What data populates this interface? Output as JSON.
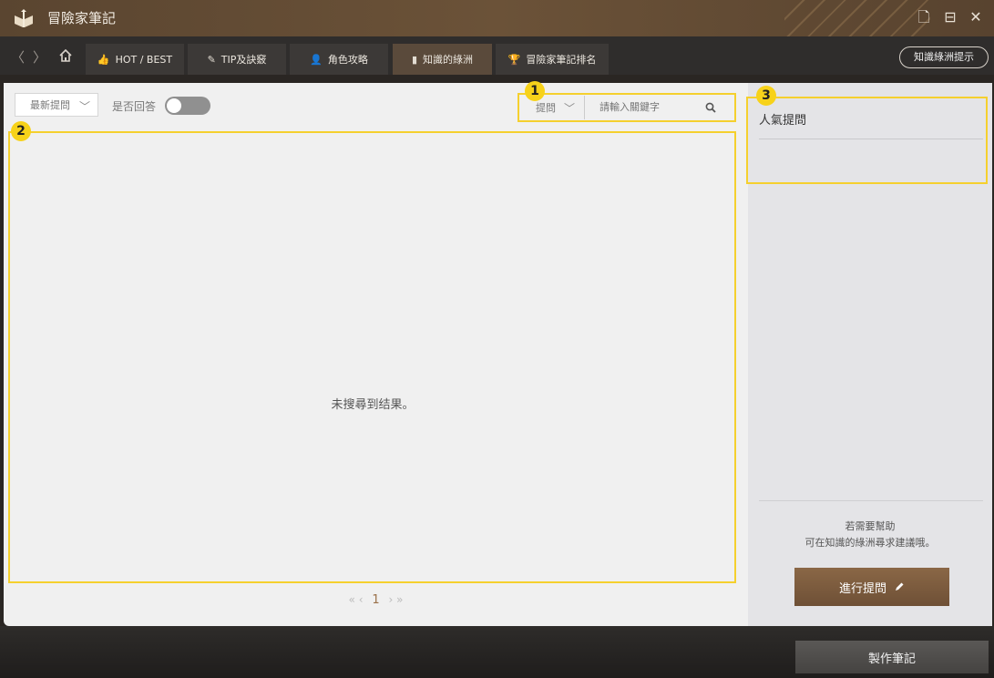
{
  "app": {
    "title": "冒險家筆記"
  },
  "window_controls": {
    "new": "🗋",
    "restore": "⊟",
    "close": "✕"
  },
  "nav": {
    "back": "〈",
    "forward": "〉",
    "tabs": [
      {
        "label": "HOT / BEST",
        "icon": "👍"
      },
      {
        "label": "TIP及訣竅",
        "icon": "✎"
      },
      {
        "label": "角色攻略",
        "icon": "👤"
      },
      {
        "label": "知識的綠洲",
        "icon": "▮"
      },
      {
        "label": "冒險家筆記排名",
        "icon": "🏆"
      }
    ],
    "hint_button": "知識綠洲提示"
  },
  "toolbar": {
    "sort_select": "最新提問",
    "answered_label": "是否回答",
    "search_type": "提問",
    "search_placeholder": "請輸入關鍵字"
  },
  "main": {
    "empty_text": "未搜尋到结果。",
    "pager": {
      "first": "«",
      "prev": "‹",
      "current": "1",
      "next": "›",
      "last": "»"
    }
  },
  "side": {
    "popular_title": "人氣提問",
    "help_line1": "若需要幫助",
    "help_line2": "可在知識的綠洲尋求建議哦。",
    "ask_button": "進行提問"
  },
  "bottom": {
    "make_note_button": "製作筆記"
  },
  "annotations": [
    "1",
    "2",
    "3"
  ],
  "colors": {
    "highlight": "#f5d02e",
    "accent": "#8a6746"
  }
}
